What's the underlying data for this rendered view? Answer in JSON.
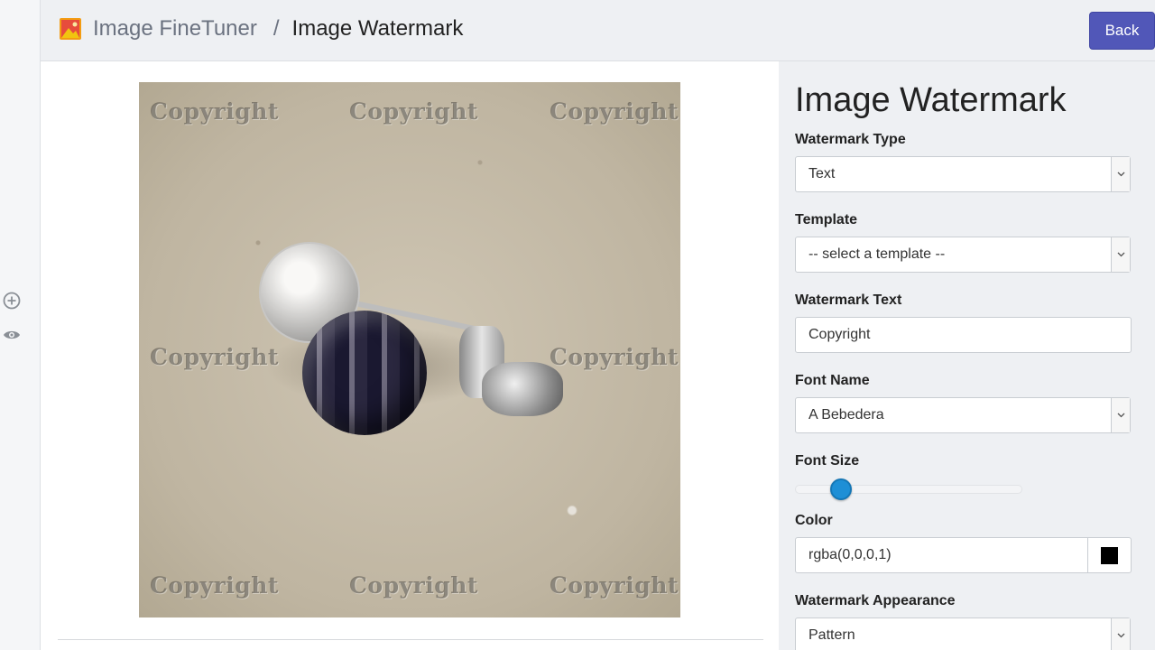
{
  "header": {
    "app_name": "Image FineTuner",
    "separator": "/",
    "page_name": "Image Watermark",
    "back_label": "Back",
    "logo_icon": "image-icon"
  },
  "rail": {
    "icons": [
      "add-circle-icon",
      "eye-icon"
    ]
  },
  "canvas": {
    "watermark_text": "Copyright",
    "watermarks": [
      "Copyright",
      "Copyright",
      "Copyright",
      "Copyright",
      "Copyright",
      "Copyright",
      "Copyright"
    ]
  },
  "panel": {
    "title": "Image Watermark",
    "watermark_type": {
      "label": "Watermark Type",
      "value": "Text"
    },
    "template": {
      "label": "Template",
      "value": "-- select a template --"
    },
    "watermark_text": {
      "label": "Watermark Text",
      "value": "Copyright"
    },
    "font_name": {
      "label": "Font Name",
      "value": "A Bebedera"
    },
    "font_size": {
      "label": "Font Size",
      "slider_fraction": 0.17
    },
    "color": {
      "label": "Color",
      "value": "rgba(0,0,0,1)",
      "swatch": "#000000"
    },
    "appearance": {
      "label": "Watermark Appearance",
      "value": "Pattern"
    }
  },
  "colors": {
    "accent": "#5157b8",
    "slider": "#1e8fd6"
  }
}
